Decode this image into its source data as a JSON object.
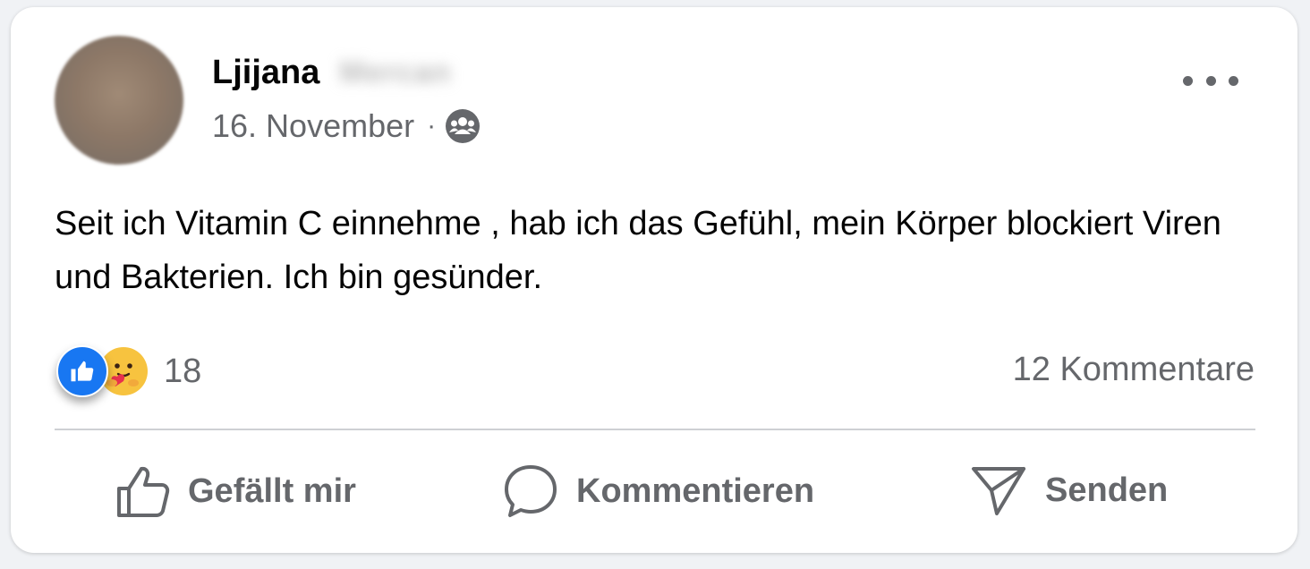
{
  "post": {
    "author_name": "Ljijana",
    "author_surname_obscured": "Mercan",
    "date": "16. November",
    "separator": "·",
    "audience_icon": "group-icon",
    "more_icon": "more-horizontal-icon",
    "text": "Seit ich Vitamin C einnehme , hab ich das Gefühl, mein Körper blockiert Viren und Bakterien. Ich bin gesünder."
  },
  "stats": {
    "reaction_icons": [
      "like-reaction-icon",
      "care-reaction-icon"
    ],
    "reaction_count": "18",
    "comments_label": "12 Kommentare"
  },
  "actions": {
    "like_label": "Gefällt mir",
    "comment_label": "Kommentieren",
    "share_label": "Senden"
  },
  "colors": {
    "like_blue": "#1877f2",
    "secondary_text": "#65676b",
    "divider": "#ced0d4"
  }
}
